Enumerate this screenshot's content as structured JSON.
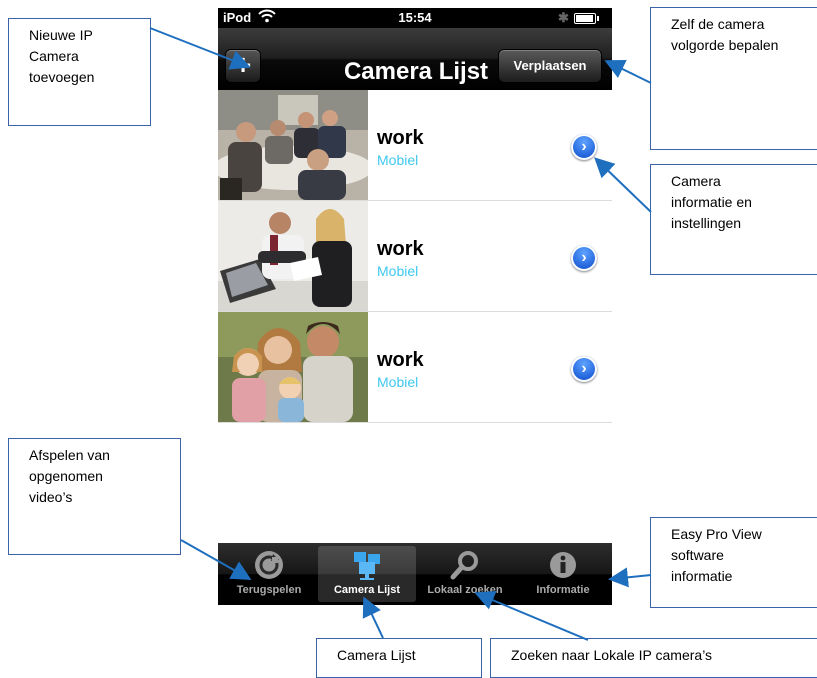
{
  "status_bar": {
    "carrier": "iPod",
    "time": "15:54"
  },
  "nav": {
    "add_label": "+",
    "title": "Camera Lijst",
    "move_label": "Verplaatsen"
  },
  "cameras": [
    {
      "name": "work",
      "type": "Mobiel"
    },
    {
      "name": "work",
      "type": "Mobiel"
    },
    {
      "name": "work",
      "type": "Mobiel"
    }
  ],
  "tabs": [
    {
      "label": "Terugspelen",
      "icon": "replay-icon"
    },
    {
      "label": "Camera Lijst",
      "icon": "camera-list-icon",
      "selected": true
    },
    {
      "label": "Lokaal zoeken",
      "icon": "search-icon"
    },
    {
      "label": "Informatie",
      "icon": "info-icon"
    }
  ],
  "callouts": {
    "new_camera": [
      "Nieuwe IP",
      "Camera",
      "toevoegen"
    ],
    "order": [
      "Zelf de camera",
      "volgorde bepalen"
    ],
    "camera_info": [
      "Camera",
      "informatie en",
      "instellingen"
    ],
    "playback": [
      "Afspelen van",
      "opgenomen",
      "video’s"
    ],
    "about": [
      "Easy Pro View",
      "software",
      "informatie"
    ],
    "camera_list": [
      "Camera Lijst"
    ],
    "local_search": [
      "Zoeken naar Lokale IP camera’s"
    ]
  },
  "colors": {
    "callout_border": "#3b63a8",
    "arrow": "#1f6fbf",
    "accent_type": "#3fc8ef"
  }
}
